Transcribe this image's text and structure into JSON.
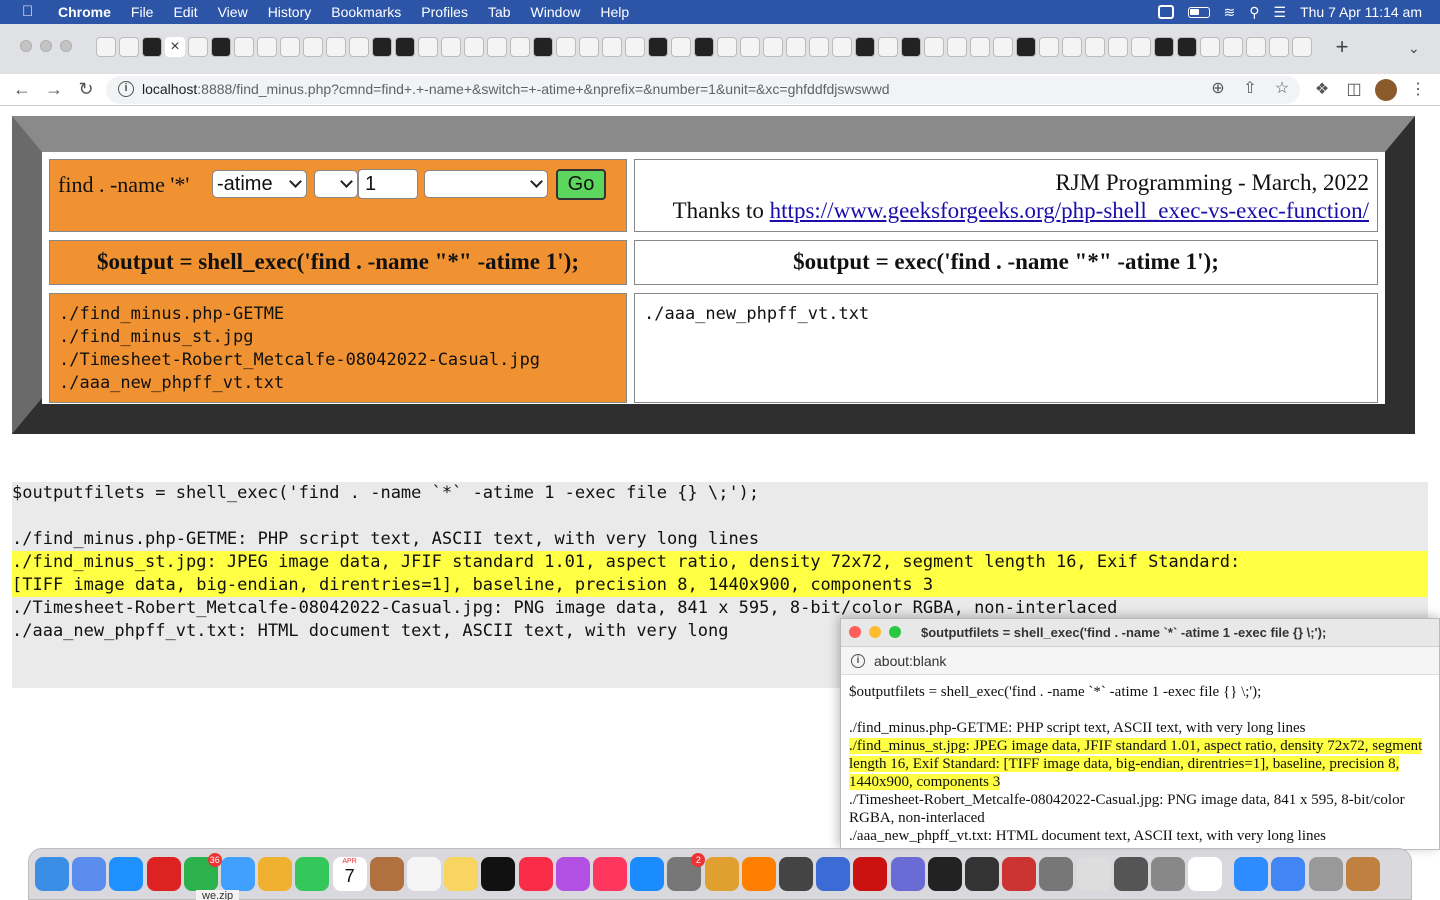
{
  "menubar": {
    "app_name": "Chrome",
    "items": [
      "File",
      "Edit",
      "View",
      "History",
      "Bookmarks",
      "Profiles",
      "Tab",
      "Window",
      "Help"
    ],
    "clock": "Thu 7 Apr  11:14 am"
  },
  "browser": {
    "url_host": "localhost",
    "url_rest": ":8888/find_minus.php?cmnd=find+.+-name+&switch=+-atime+&nprefix=&number=1&unit=&xc=ghfddfdjswswwd",
    "new_tab": "+",
    "tab_count": 53
  },
  "form": {
    "label": "find . -name '*'",
    "switch_value": "-atime",
    "prefix_value": "",
    "number_value": "1",
    "unit_value": "",
    "go_label": "Go"
  },
  "credit": {
    "line1": "RJM Programming - March, 2022",
    "thanks": "Thanks to ",
    "link": "https://www.geeksforgeeks.org/php-shell_exec-vs-exec-function/"
  },
  "headers": {
    "shell_exec": "$output = shell_exec('find . -name \"*\" -atime 1');",
    "exec": "$output = exec('find . -name \"*\" -atime 1');"
  },
  "shell_exec_output": [
    "./find_minus.php-GETME",
    "./find_minus_st.jpg",
    "./Timesheet-Robert_Metcalfe-08042022-Casual.jpg",
    "./aaa_new_phpff_vt.txt"
  ],
  "exec_output": "./aaa_new_phpff_vt.txt",
  "filetypes": {
    "command": "$outputfilets = shell_exec('find . -name `*`  -atime 1 -exec file {} \\;');",
    "line1": "./find_minus.php-GETME: PHP script text, ASCII text, with very long lines",
    "line2a": "./find_minus_st.jpg: JPEG image data, JFIF standard 1.01, aspect ratio, density 72x72, segment length 16, Exif Standard:",
    "line2b": "[TIFF image data, big-endian, direntries=1], baseline, precision 8, 1440x900, components 3",
    "line3": "./Timesheet-Robert_Metcalfe-08042022-Casual.jpg: PNG image data, 841 x 595, 8-bit/color RGBA, non-interlaced",
    "line4": "./aaa_new_phpff_vt.txt: HTML document text, ASCII text, with very long"
  },
  "popup": {
    "title": "$outputfilets = shell_exec('find . -name `*` -atime 1 -exec file {} \\;');",
    "url": "about:blank",
    "command": "$outputfilets = shell_exec('find . -name `*` -atime 1 -exec file {} \\;');",
    "line1": "./find_minus.php-GETME: PHP script text, ASCII text, with very long lines",
    "line2": "./find_minus_st.jpg: JPEG image data, JFIF standard 1.01, aspect ratio, density 72x72, segment length 16, Exif Standard: [TIFF image data, big-endian, direntries=1], baseline, precision 8, 1440x900, components 3",
    "line3": "./Timesheet-Robert_Metcalfe-08042022-Casual.jpg: PNG image data, 841 x 595, 8-bit/color RGBA, non-interlaced",
    "line4": "./aaa_new_phpff_vt.txt: HTML document text, ASCII text, with very long lines"
  },
  "dock": {
    "calendar_month": "APR",
    "calendar_day": "7",
    "messages_badge": "36",
    "settings_badge": "2"
  },
  "bottom_strip": "we.zip",
  "colors": {
    "menubar": "#2c55a8",
    "orange_cell": "#f09232",
    "go_button": "#5cd65c",
    "highlight": "#ffff44",
    "link": "#1a0dab"
  }
}
